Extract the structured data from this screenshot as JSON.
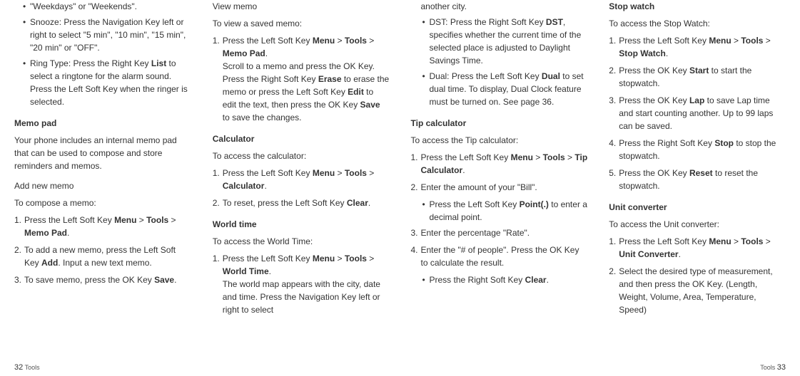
{
  "col1": {
    "bullet1_a": "\"Weekdays\" or \"Weekends\".",
    "bullet2_a": "Snooze: Press the Navigation Key left or right to select \"5 min\", \"10 min\", \"15 min\", \"20 min\" or \"OFF\".",
    "bullet3_a": "Ring Type: Press the Right Key ",
    "bullet3_bold": "List",
    "bullet3_b": " to select a ringtone for the alarm sound. Press the Left Soft Key when the ringer is selected.",
    "h2_memopad": "Memo pad",
    "memopad_intro": "Your phone includes an internal memo pad that can be used to compose and store reminders and memos.",
    "h3_addnew": "Add new memo",
    "addnew_intro": "To compose a memo:",
    "step1_a": "Press the Left Soft Key ",
    "step1_bold1": "Menu",
    "step1_b": " > ",
    "step1_bold2": "Tools",
    "step1_c": " > ",
    "step1_bold3": "Memo Pad",
    "step1_d": ".",
    "step2_a": "To add a new memo, press the Left Soft Key ",
    "step2_bold": "Add",
    "step2_b": ". Input a new text memo.",
    "step3_a": "To save memo, press the OK Key ",
    "step3_bold": "Save",
    "step3_b": "."
  },
  "col2": {
    "h3_view": "View memo",
    "view_intro": "To view a saved memo:",
    "vstep1_a": "Press the Left Soft Key ",
    "vstep1_bold1": "Menu",
    "vstep1_b": " > ",
    "vstep1_bold2": "Tools",
    "vstep1_c": " > ",
    "vstep1_bold3": "Memo Pad",
    "vstep1_d": ".",
    "vstep1_cont_a": "Scroll to a memo and press the OK Key. Press the Right Soft Key ",
    "vstep1_cont_bold1": "Erase",
    "vstep1_cont_b": " to erase the memo or press the Left Soft Key ",
    "vstep1_cont_bold2": "Edit",
    "vstep1_cont_c": " to edit the text, then press the OK Key ",
    "vstep1_cont_bold3": "Save",
    "vstep1_cont_d": " to save the changes.",
    "h2_calc": "Calculator",
    "calc_intro": "To access the calculator:",
    "cstep1_a": "Press the Left Soft Key ",
    "cstep1_bold1": "Menu",
    "cstep1_b": " > ",
    "cstep1_bold2": "Tools",
    "cstep1_c": " > ",
    "cstep1_bold3": "Calculator",
    "cstep1_d": ".",
    "cstep2_a": "To reset, press the Left Soft Key ",
    "cstep2_bold": "Clear",
    "cstep2_b": ".",
    "h2_world": "World time",
    "world_intro": "To access the World Time:",
    "wstep1_a": "Press the Left Soft Key ",
    "wstep1_bold1": "Menu",
    "wstep1_b": " > ",
    "wstep1_bold2": "Tools",
    "wstep1_c": " > ",
    "wstep1_bold3": "World Time",
    "wstep1_d": ".",
    "wstep1_cont": "The world map appears with the city, date and time. Press the Navigation Key left or right to select"
  },
  "col3": {
    "top": "another city.",
    "dst_a": "DST: Press the Right Soft Key ",
    "dst_bold": "DST",
    "dst_b": ", specifies whether the current time of the selected place is adjusted to Daylight Savings Time.",
    "dual_a": "Dual: Press the Left Soft Key ",
    "dual_bold": "Dual",
    "dual_b": " to set dual time. To display, Dual Clock feature must be turned on. See page 36.",
    "h2_tip": "Tip calculator",
    "tip_intro": "To access the Tip calculator:",
    "tstep1_a": "Press the Left Soft Key ",
    "tstep1_bold1": "Menu",
    "tstep1_b": " > ",
    "tstep1_bold2": "Tools",
    "tstep1_c": " > ",
    "tstep1_bold3": "Tip Calculator",
    "tstep1_d": ".",
    "tstep2": "Enter the amount of your \"Bill\".",
    "tstep2_sub_a": "Press the Left Soft Key ",
    "tstep2_sub_bold": "Point(.)",
    "tstep2_sub_b": " to enter a decimal point.",
    "tstep3": "Enter the percentage \"Rate\".",
    "tstep4": "Enter the \"# of people\". Press the OK Key to calculate the result.",
    "tstep4_sub_a": "Press the Right Soft Key ",
    "tstep4_sub_bold": "Clear",
    "tstep4_sub_b": "."
  },
  "col4": {
    "h2_stop": "Stop watch",
    "stop_intro": "To access the Stop Watch:",
    "sstep1_a": "Press the Left Soft Key ",
    "sstep1_bold1": "Menu",
    "sstep1_b": " > ",
    "sstep1_bold2": "Tools",
    "sstep1_c": " > ",
    "sstep1_bold3": "Stop Watch",
    "sstep1_d": ".",
    "sstep2_a": "Press the OK Key ",
    "sstep2_bold": "Start",
    "sstep2_b": " to start the stopwatch.",
    "sstep3_a": "Press the OK Key ",
    "sstep3_bold": "Lap",
    "sstep3_b": " to save Lap time and start counting another. Up to 99 laps can be saved.",
    "sstep4_a": "Press the Right Soft Key ",
    "sstep4_bold": "Stop",
    "sstep4_b": " to stop the stopwatch.",
    "sstep5_a": "Press the OK Key ",
    "sstep5_bold": "Reset",
    "sstep5_b": " to reset the stopwatch.",
    "h2_unit": "Unit converter",
    "unit_intro": "To access the Unit converter:",
    "ustep1_a": "Press the Left Soft Key ",
    "ustep1_bold1": "Menu",
    "ustep1_b": " > ",
    "ustep1_bold2": "Tools",
    "ustep1_c": " > ",
    "ustep1_bold3": "Unit Converter",
    "ustep1_d": ".",
    "ustep2": "Select the desired type of measurement, and then press the OK Key. (Length, Weight, Volume, Area, Temperature, Speed)"
  },
  "footer": {
    "left_page": "32",
    "left_label": "Tools",
    "right_label": "Tools",
    "right_page": "33"
  }
}
